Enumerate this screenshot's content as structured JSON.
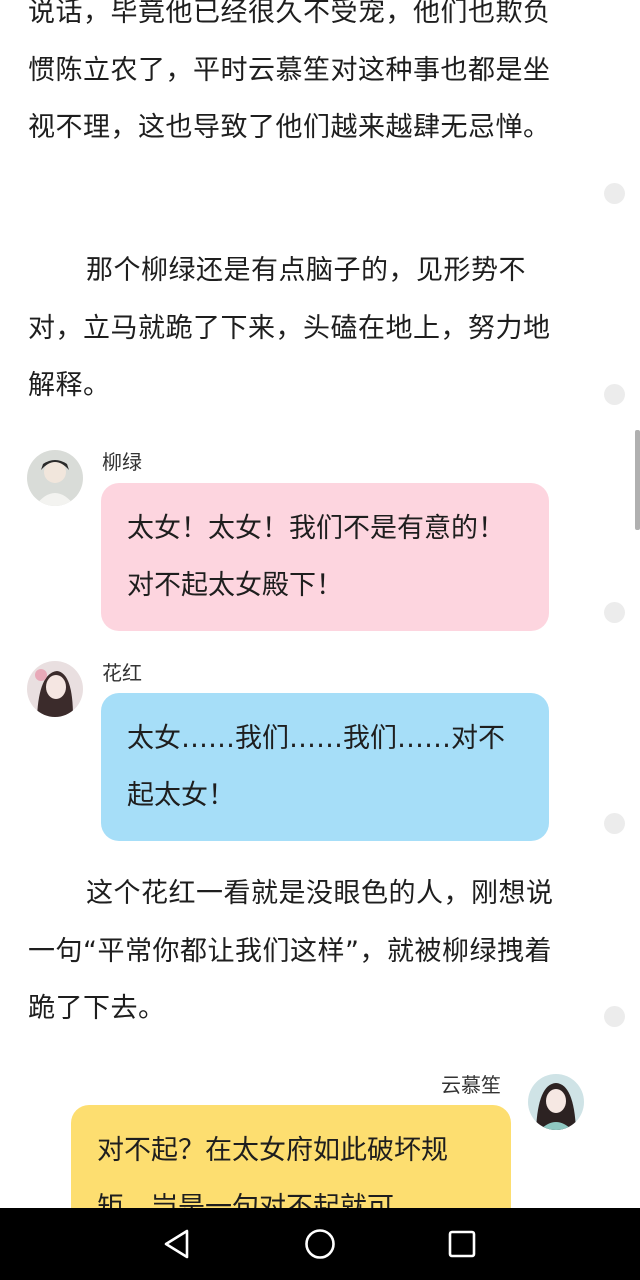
{
  "paragraphs": [
    "说话，毕竟他已经很久不受宠，他们也欺负惯陈立农了，平时云慕笙对这种事也都是坐视不理，这也导致了他们越来越肆无忌惮。",
    "那个柳绿还是有点脑子的，见形势不对，立马就跪了下来，头磕在地上，努力地解释。",
    "这个花红一看就是没眼色的人，刚想说一句“平常你都让我们这样”，就被柳绿拽着跪了下去。"
  ],
  "messages": [
    {
      "speaker": "柳绿",
      "text": "太女！太女！我们不是有意的！对不起太女殿下！",
      "color": "#fdd5df"
    },
    {
      "speaker": "花红",
      "text": "太女……我们……我们……对不起太女！",
      "color": "#a6def8"
    },
    {
      "speaker": "云慕笙",
      "text": "对不起？在太女府如此破坏规矩，岂是一句对不起就可",
      "color": "#fdde70"
    }
  ],
  "icons": {
    "back": "triangle-back-icon",
    "home": "circle-home-icon",
    "recents": "square-recents-icon"
  }
}
